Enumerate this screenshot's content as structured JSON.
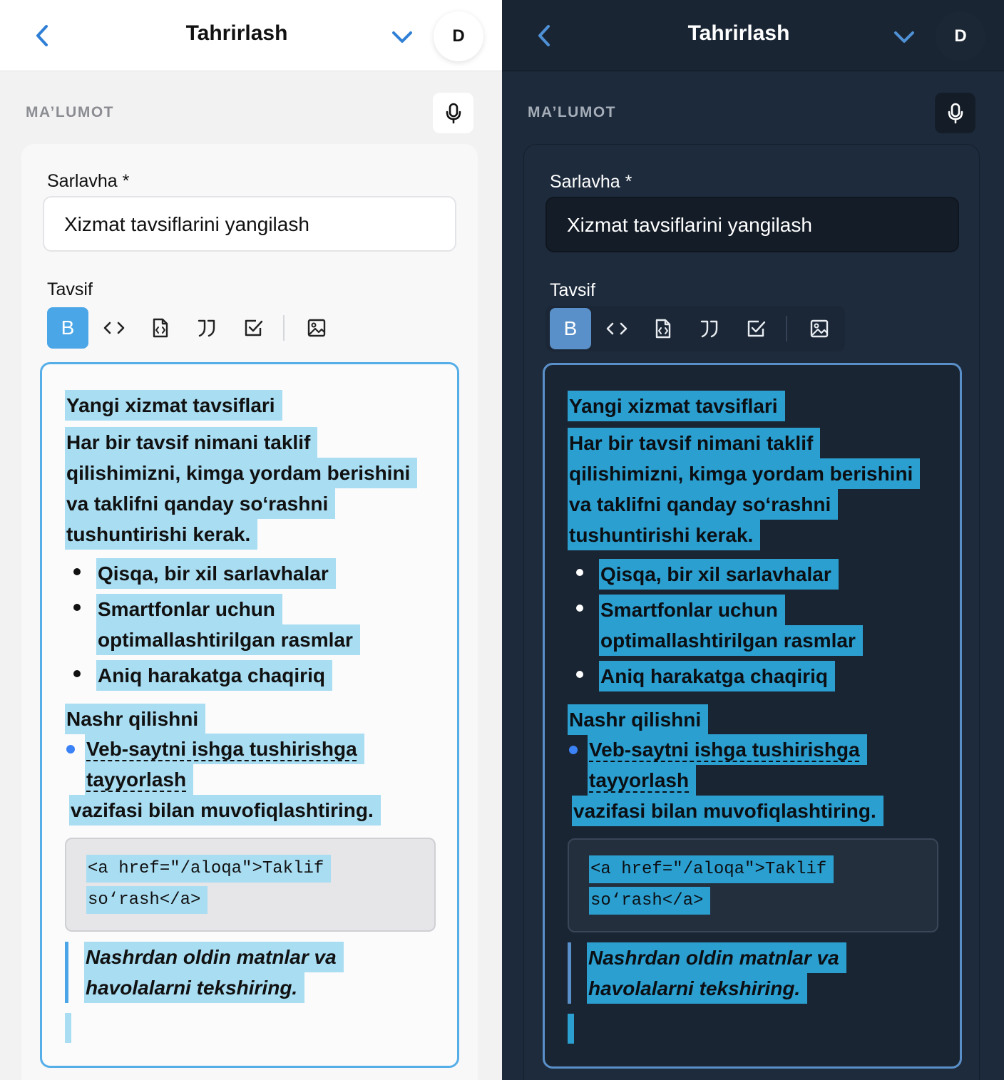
{
  "header": {
    "title": "Tahrirlash",
    "avatar_letter": "D"
  },
  "section": {
    "label": "MA’LUMOT"
  },
  "form": {
    "title_label": "Sarlavha *",
    "title_value": "Xizmat tavsiflarini yangilash",
    "desc_label": "Tavsif"
  },
  "toolbar": {
    "bold": "B"
  },
  "editor": {
    "heading": "Yangi xizmat tavsiflari",
    "paragraph": "Har bir tavsif nimani taklif qilishimizni, kimga yordam berishini va taklifni qanday so‘rashni tushuntirishi kerak.",
    "bullets": [
      "Qisqa, bir xil sarlavhalar",
      "Smartfonlar uchun optimallashtirilgan rasmlar",
      "Aniq harakatga chaqiriq"
    ],
    "publish": "Nashr qilishni",
    "task": "Veb-saytni ishga tushirishga tayyorlash",
    "assign": "vazifasi bilan muvofiqlashtiring.",
    "code": "<a href=\"/aloqa\">Taklif so‘rash</a>",
    "quote": "Nashrdan oldin matnlar va havolalarni tekshiring."
  },
  "colors": {
    "accent_light": "#4aa6e6",
    "accent_dark": "#5a90c9",
    "highlight_light": "#a9ddf2",
    "highlight_dark": "#2b9fd0",
    "task_dot": "#3b82f6"
  },
  "icons": [
    "back-icon",
    "chevron-down-icon",
    "mic-icon",
    "bold-icon",
    "code-icon",
    "code-file-icon",
    "quote-icon",
    "checkbox-icon",
    "image-icon"
  ]
}
